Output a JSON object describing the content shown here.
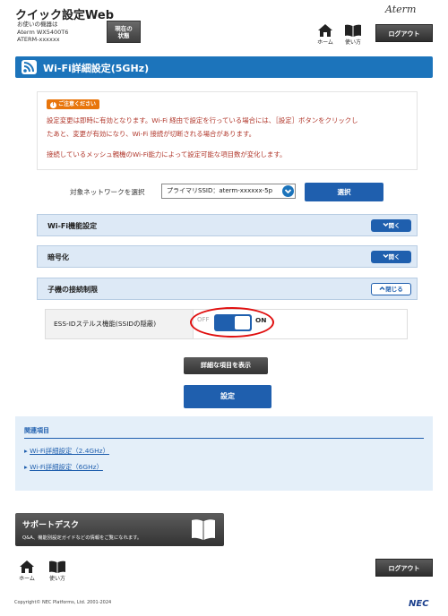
{
  "header": {
    "app_title": "クイック設定Web",
    "device_lines": [
      "お使いの機器は",
      "Aterm WX5400T6",
      "ATERM-xxxxxx"
    ],
    "status_button": [
      "現在の",
      "状態"
    ],
    "brand": "Aterm",
    "home_label": "ホーム",
    "help_label": "使い方",
    "logout_label": "ログアウト"
  },
  "page": {
    "title": "Wi-Fi詳細設定(5GHz)"
  },
  "notice": {
    "caution_label": "ご注意ください",
    "lines": [
      "設定変更は即時に有効となります。Wi-Fi 経由で設定を行っている場合には、［設定］ボタンをクリックし",
      "たあと、変更が有効になり、Wi-Fi 接続が切断される場合があります。",
      "接続しているメッシュ親機のWi-Fi能力によって設定可能な項目数が変化します。"
    ]
  },
  "network": {
    "label": "対象ネットワークを選択",
    "selected": "プライマリSSID：aterm-xxxxxx-5p",
    "select_button": "選択"
  },
  "sections": [
    {
      "label": "Wi-Fi機能設定",
      "toggle": "開く",
      "expanded": false
    },
    {
      "label": "暗号化",
      "toggle": "開く",
      "expanded": false
    },
    {
      "label": "子機の接続制限",
      "toggle": "閉じる",
      "expanded": true
    }
  ],
  "setting": {
    "label": "ESS-IDステルス機能(SSIDの隠蔽)",
    "off_label": "OFF",
    "on_label": "ON",
    "state": "ON"
  },
  "buttons": {
    "detail": "詳細な項目を表示",
    "save": "設定"
  },
  "related": {
    "heading": "関連項目",
    "links": [
      "Wi-Fi詳細設定（2.4GHz）",
      "Wi-Fi詳細設定（6GHz）"
    ]
  },
  "support": {
    "title": "サポートデスク",
    "subtitle": "Q&A、機能別設定ガイドなどの情報をご覧になれます。"
  },
  "footer": {
    "home_label": "ホーム",
    "help_label": "使い方",
    "logout_label": "ログアウト",
    "copyright": "Copyright© NEC Platforms, Ltd. 2001-2024",
    "company": "NEC"
  },
  "colors": {
    "primary": "#1f5fae",
    "title_bar": "#1c74bb",
    "accordion": "#dde9f6",
    "caution": "#e8750b",
    "notice_text": "#b0362a",
    "highlight": "#e01010"
  }
}
